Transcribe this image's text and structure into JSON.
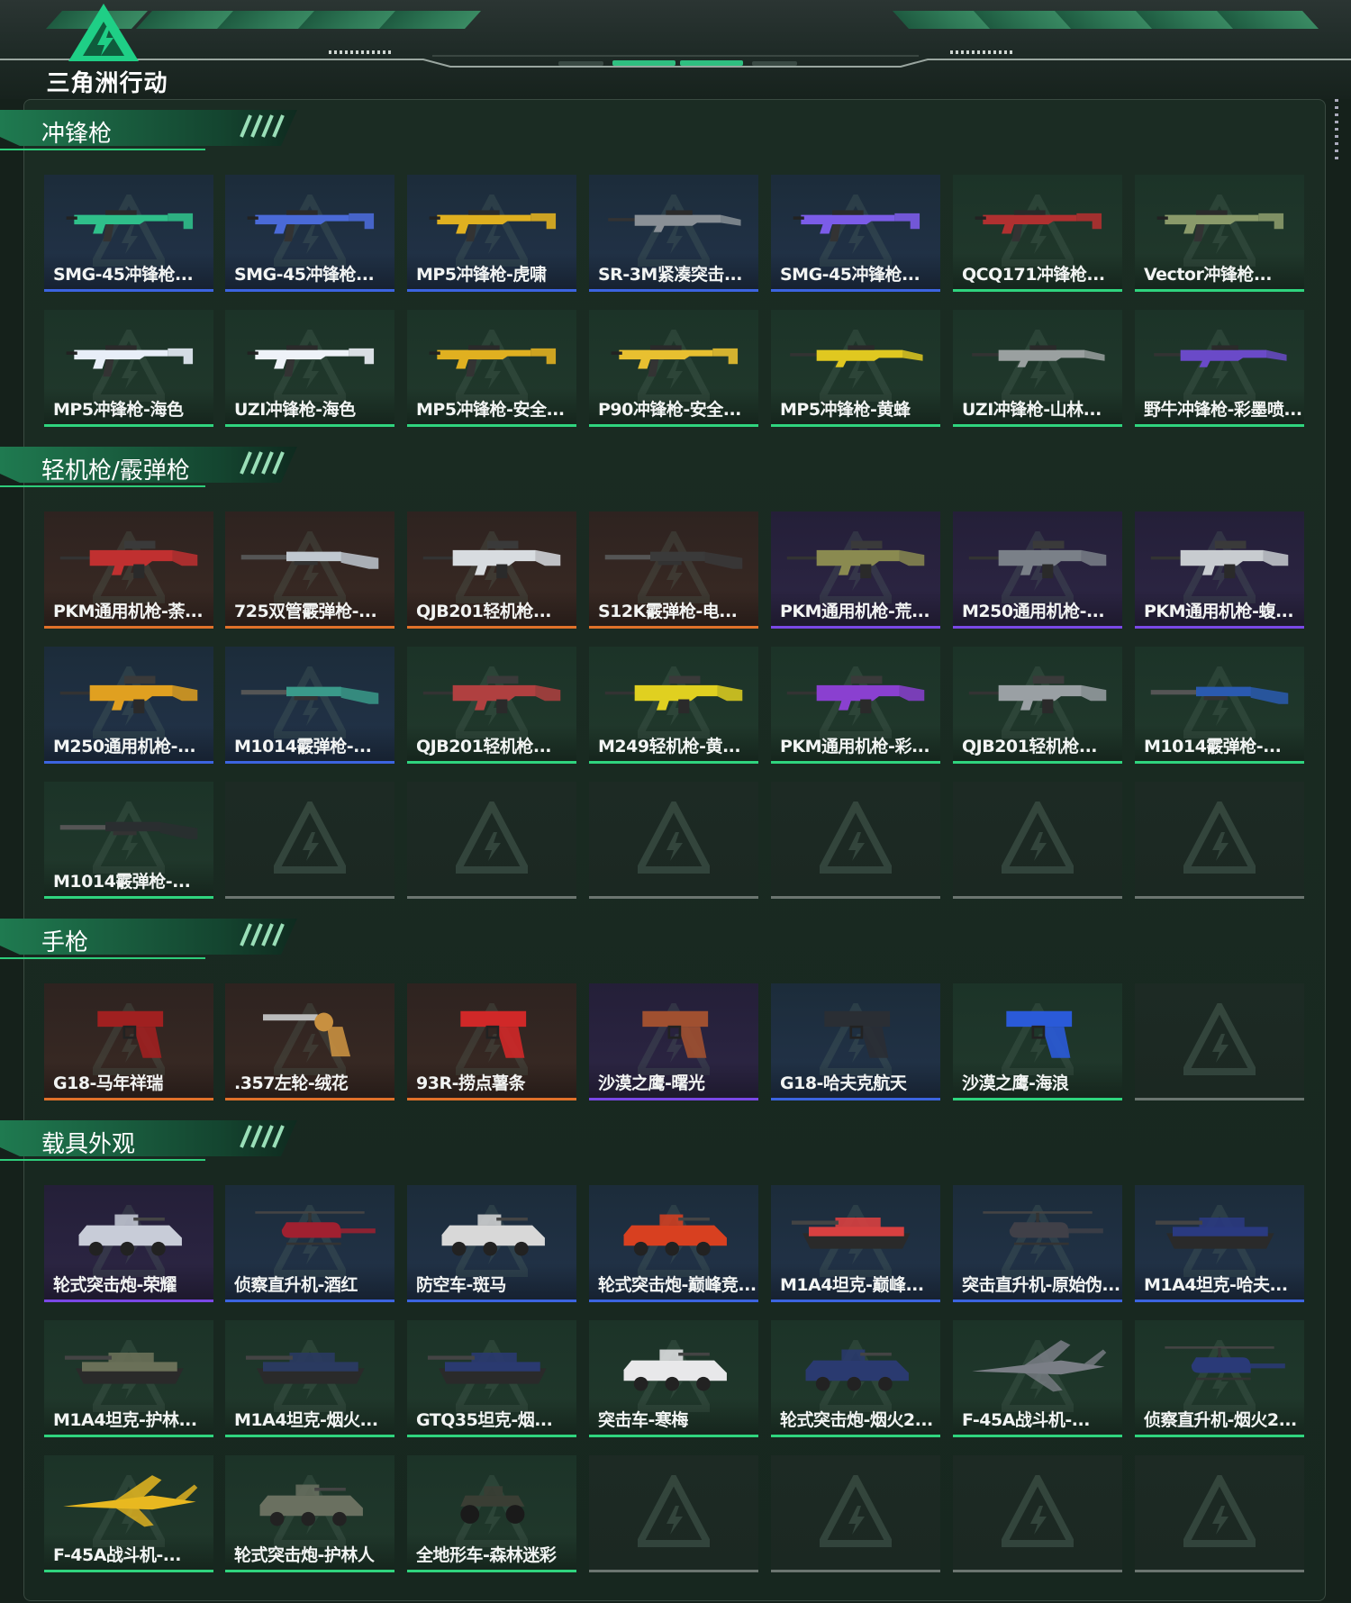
{
  "app": {
    "logo_text": "三角洲行动",
    "logo_icon": "delta-triangle-logo-icon"
  },
  "colors": {
    "background": "#15211b",
    "accent_green": "#2ecc7a",
    "rarity_blue": "#3c64e0",
    "rarity_purple": "#7a48e6",
    "rarity_orange": "#e0712a",
    "rarity_green": "#2fd47e",
    "empty_slot": "#6b7570"
  },
  "sections": [
    {
      "title": "冲锋枪",
      "items": [
        {
          "label": "SMG-45冲锋枪...",
          "rarity": "blue",
          "icon": "smg-icon",
          "color": "#2fbf8a"
        },
        {
          "label": "SMG-45冲锋枪...",
          "rarity": "blue",
          "icon": "smg-icon",
          "color": "#4a6ad8"
        },
        {
          "label": "MP5冲锋枪-虎啸",
          "rarity": "blue",
          "icon": "smg-icon",
          "color": "#e0b020"
        },
        {
          "label": "SR-3M紧凑突击...",
          "rarity": "blue",
          "icon": "rifle-icon",
          "color": "#8a9096"
        },
        {
          "label": "SMG-45冲锋枪...",
          "rarity": "blue",
          "icon": "smg-icon",
          "color": "#7b5ce8"
        },
        {
          "label": "QCQ171冲锋枪...",
          "rarity": "green",
          "icon": "smg-icon",
          "color": "#b03030"
        },
        {
          "label": "Vector冲锋枪...",
          "rarity": "green",
          "icon": "smg-icon",
          "color": "#8a9a6a"
        },
        {
          "label": "MP5冲锋枪-海色",
          "rarity": "green",
          "icon": "smg-icon",
          "color": "#e8eef8"
        },
        {
          "label": "UZI冲锋枪-海色",
          "rarity": "green",
          "icon": "smg-icon",
          "color": "#eef2f8"
        },
        {
          "label": "MP5冲锋枪-安全...",
          "rarity": "green",
          "icon": "smg-icon",
          "color": "#e0b020"
        },
        {
          "label": "P90冲锋枪-安全...",
          "rarity": "green",
          "icon": "smg-icon",
          "color": "#e8c030"
        },
        {
          "label": "MP5冲锋枪-黄蜂",
          "rarity": "green",
          "icon": "rifle-icon",
          "color": "#e0c820"
        },
        {
          "label": "UZI冲锋枪-山林...",
          "rarity": "green",
          "icon": "rifle-icon",
          "color": "#9aa0a0"
        },
        {
          "label": "野牛冲锋枪-彩墨喷...",
          "rarity": "green",
          "icon": "rifle-icon",
          "color": "#6a4ac8"
        }
      ],
      "empty_slots": 0
    },
    {
      "title": "轻机枪/霰弹枪",
      "items": [
        {
          "label": "PKM通用机枪-荼...",
          "rarity": "orange",
          "icon": "machine-gun-icon",
          "color": "#c03030"
        },
        {
          "label": "725双管霰弹枪-...",
          "rarity": "orange",
          "icon": "shotgun-icon",
          "color": "#c0c8d0"
        },
        {
          "label": "QJB201轻机枪...",
          "rarity": "orange",
          "icon": "machine-gun-icon",
          "color": "#d8dce0"
        },
        {
          "label": "S12K霰弹枪-电...",
          "rarity": "orange",
          "icon": "shotgun-icon",
          "color": "#3a3a3a"
        },
        {
          "label": "PKM通用机枪-荒...",
          "rarity": "purple",
          "icon": "machine-gun-icon",
          "color": "#8a8a50"
        },
        {
          "label": "M250通用机枪-...",
          "rarity": "purple",
          "icon": "machine-gun-icon",
          "color": "#7a8088"
        },
        {
          "label": "PKM通用机枪-蝮...",
          "rarity": "purple",
          "icon": "machine-gun-icon",
          "color": "#c8ccd0"
        },
        {
          "label": "M250通用机枪-...",
          "rarity": "blue",
          "icon": "machine-gun-icon",
          "color": "#e0a020"
        },
        {
          "label": "M1014霰弹枪-...",
          "rarity": "blue",
          "icon": "shotgun-icon",
          "color": "#3a9a8a"
        },
        {
          "label": "QJB201轻机枪...",
          "rarity": "green",
          "icon": "machine-gun-icon",
          "color": "#b04040"
        },
        {
          "label": "M249轻机枪-黄...",
          "rarity": "green",
          "icon": "machine-gun-icon",
          "color": "#e0d020"
        },
        {
          "label": "PKM通用机枪-彩...",
          "rarity": "green",
          "icon": "machine-gun-icon",
          "color": "#8a40d0"
        },
        {
          "label": "QJB201轻机枪...",
          "rarity": "green",
          "icon": "machine-gun-icon",
          "color": "#9aa0a4"
        },
        {
          "label": "M1014霰弹枪-...",
          "rarity": "green",
          "icon": "shotgun-icon",
          "color": "#2a5ab0"
        },
        {
          "label": "M1014霰弹枪-...",
          "rarity": "green",
          "icon": "shotgun-icon",
          "color": "#2a2e30"
        }
      ],
      "empty_slots": 6
    },
    {
      "title": "手枪",
      "items": [
        {
          "label": "G18-马年祥瑞",
          "rarity": "orange",
          "icon": "pistol-icon",
          "color": "#a02020"
        },
        {
          "label": ".357左轮-绒花",
          "rarity": "orange",
          "icon": "revolver-icon",
          "color": "#c89040"
        },
        {
          "label": "93R-捞点薯条",
          "rarity": "orange",
          "icon": "pistol-icon",
          "color": "#d02828"
        },
        {
          "label": "沙漠之鹰-曙光",
          "rarity": "purple",
          "icon": "pistol-icon",
          "color": "#a05030"
        },
        {
          "label": "G18-哈夫克航天",
          "rarity": "blue",
          "icon": "pistol-icon",
          "color": "#2a2e34"
        },
        {
          "label": "沙漠之鹰-海浪",
          "rarity": "green",
          "icon": "pistol-icon",
          "color": "#2a5ad8"
        }
      ],
      "empty_slots": 1
    },
    {
      "title": "载具外观",
      "items": [
        {
          "label": "轮式突击炮-荣耀",
          "rarity": "purple",
          "icon": "armored-vehicle-icon",
          "color": "#c8ccd8"
        },
        {
          "label": "侦察直升机-酒红",
          "rarity": "blue",
          "icon": "helicopter-icon",
          "color": "#a02030"
        },
        {
          "label": "防空车-斑马",
          "rarity": "blue",
          "icon": "armored-vehicle-icon",
          "color": "#d8d8d8"
        },
        {
          "label": "轮式突击炮-巅峰竞...",
          "rarity": "blue",
          "icon": "armored-vehicle-icon",
          "color": "#d84020"
        },
        {
          "label": "M1A4坦克-巅峰...",
          "rarity": "blue",
          "icon": "tank-icon",
          "color": "#d84040"
        },
        {
          "label": "突击直升机-原始伪...",
          "rarity": "blue",
          "icon": "helicopter-icon",
          "color": "#404048"
        },
        {
          "label": "M1A4坦克-哈夫...",
          "rarity": "blue",
          "icon": "tank-icon",
          "color": "#2a3a80"
        },
        {
          "label": "M1A4坦克-护林...",
          "rarity": "green",
          "icon": "tank-icon",
          "color": "#6a7058"
        },
        {
          "label": "M1A4坦克-烟火...",
          "rarity": "green",
          "icon": "tank-icon",
          "color": "#2a3a60"
        },
        {
          "label": "GTQ35坦克-烟...",
          "rarity": "green",
          "icon": "tank-icon",
          "color": "#2a3a70"
        },
        {
          "label": "突击车-寒梅",
          "rarity": "green",
          "icon": "armored-vehicle-icon",
          "color": "#e8e8ea"
        },
        {
          "label": "轮式突击炮-烟火2...",
          "rarity": "green",
          "icon": "armored-vehicle-icon",
          "color": "#2a3a70"
        },
        {
          "label": "F-45A战斗机-...",
          "rarity": "green",
          "icon": "fighter-jet-icon",
          "color": "#7a7e86"
        },
        {
          "label": "侦察直升机-烟火2...",
          "rarity": "green",
          "icon": "helicopter-icon",
          "color": "#2a3a78"
        },
        {
          "label": "F-45A战斗机-...",
          "rarity": "green",
          "icon": "fighter-jet-icon",
          "color": "#e8b820"
        },
        {
          "label": "轮式突击炮-护林人",
          "rarity": "green",
          "icon": "armored-vehicle-icon",
          "color": "#6a7060"
        },
        {
          "label": "全地形车-森林迷彩",
          "rarity": "green",
          "icon": "atv-icon",
          "color": "#3a3e34"
        }
      ],
      "empty_slots": 4
    }
  ]
}
